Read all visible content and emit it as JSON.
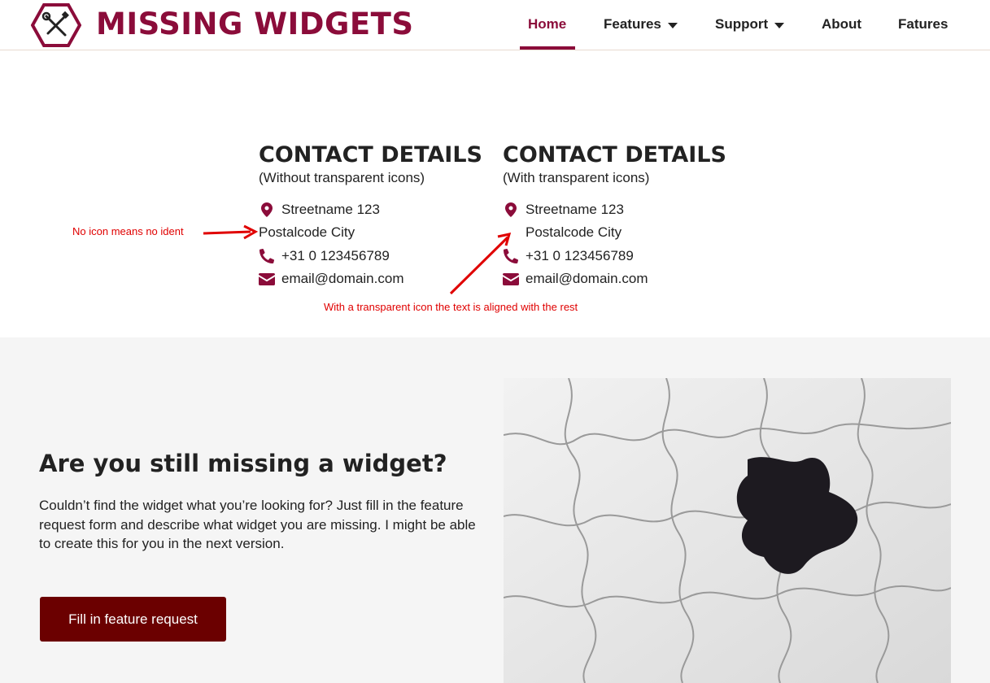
{
  "header": {
    "brand": "MISSING WIDGETS",
    "nav": [
      {
        "label": "Home",
        "active": true
      },
      {
        "label": "Features",
        "dropdown": true
      },
      {
        "label": "Support",
        "dropdown": true
      },
      {
        "label": "About"
      },
      {
        "label": "Fatures"
      }
    ]
  },
  "contact_left": {
    "title": "CONTACT DETAILS",
    "subtitle": "(Without transparent icons)",
    "address": "Streetname 123",
    "city": "Postalcode City",
    "phone": "+31 0 123456789",
    "email": "email@domain.com"
  },
  "contact_right": {
    "title": "CONTACT DETAILS",
    "subtitle": "(With transparent icons)",
    "address": "Streetname 123",
    "city": "Postalcode City",
    "phone": "+31 0 123456789",
    "email": "email@domain.com"
  },
  "annotations": {
    "left": "No icon means no ident",
    "bottom": "With a transparent icon the text is aligned with the rest"
  },
  "cta_section": {
    "title": "Are you still missing a widget?",
    "text": "Couldn’t find the widget what you’re looking for? Just fill in the feature request form and describe what widget you are missing. I might be able to create this for you in the next version.",
    "button": "Fill in feature request"
  },
  "colors": {
    "brand": "#8b0c3a",
    "button": "#6b0000",
    "annotation": "#e00000"
  },
  "icons": [
    "tools-hexagon-logo-icon",
    "map-pin-icon",
    "phone-icon",
    "envelope-icon",
    "chevron-down-icon",
    "puzzle-image"
  ]
}
